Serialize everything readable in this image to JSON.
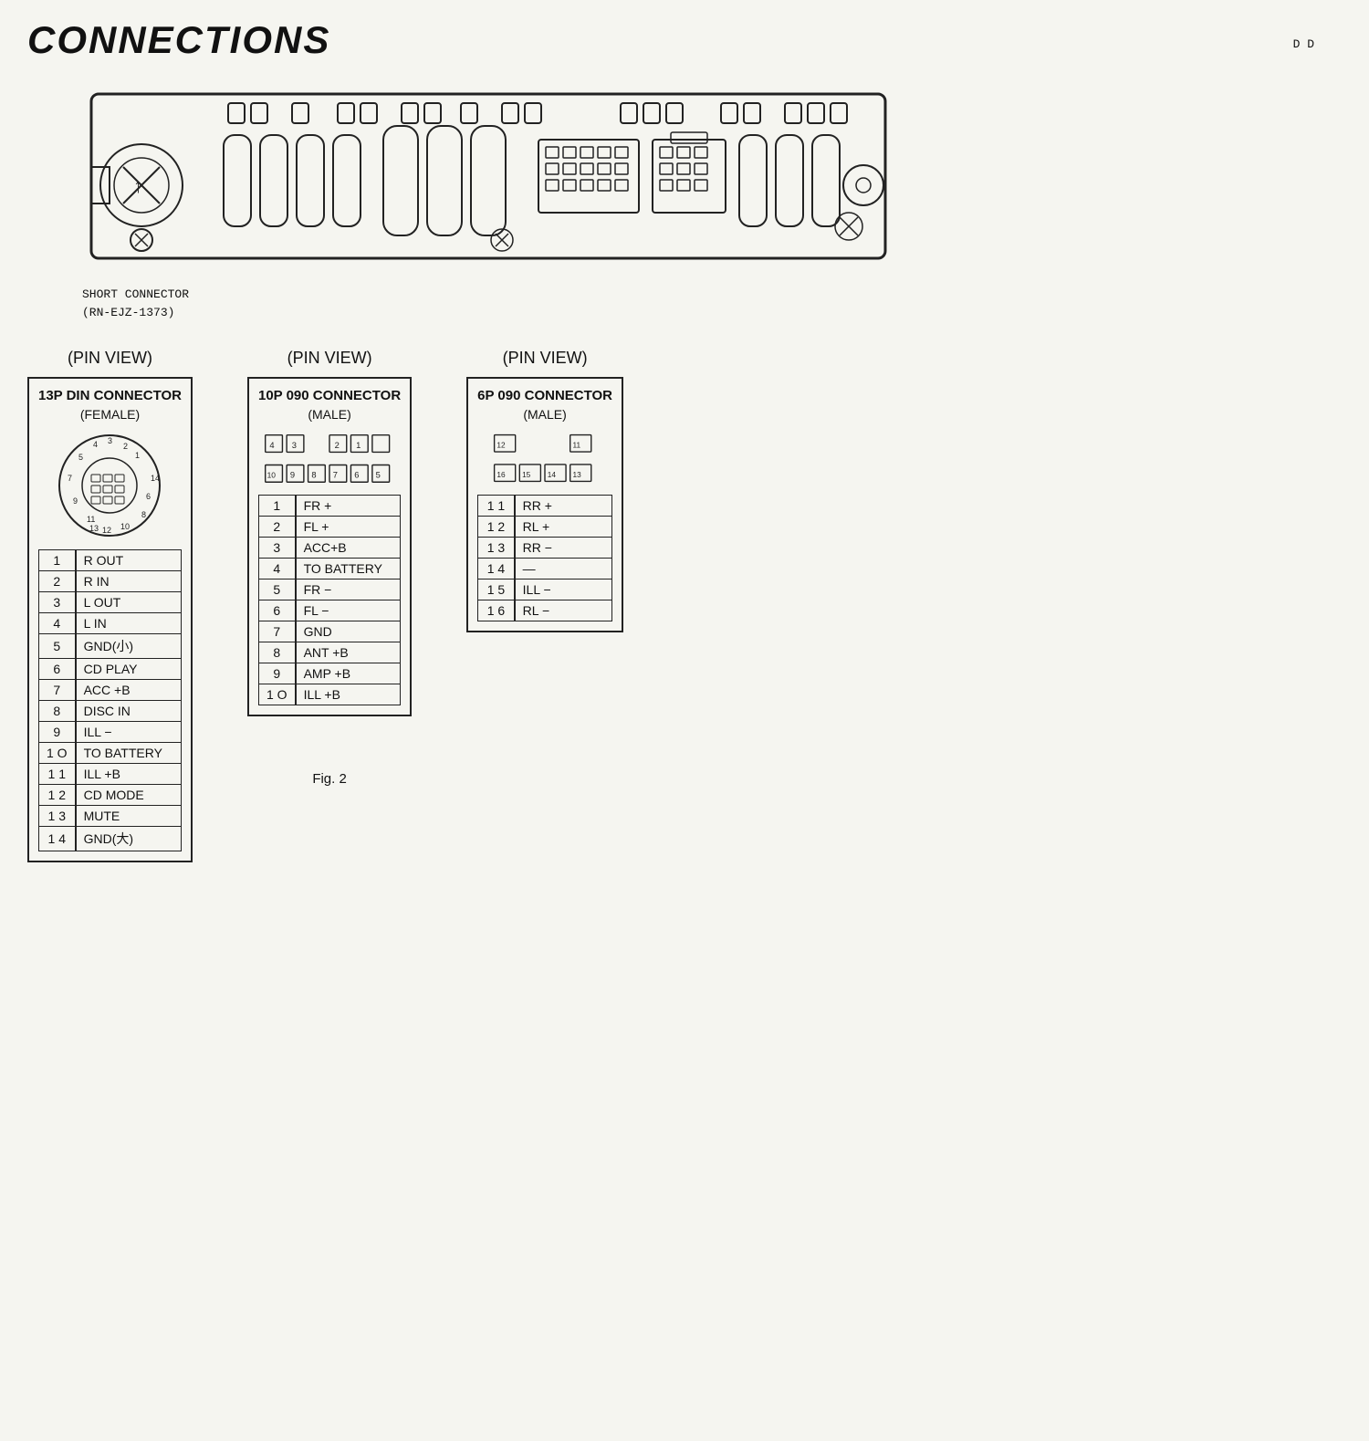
{
  "title": "CONNECTIONS",
  "top_right": "D\nD",
  "short_connector_label": "SHORT CONNECTOR",
  "short_connector_part": "(RN-EJZ-1373)",
  "fig_label": "Fig. 2",
  "connectors": [
    {
      "pin_view_label": "(PIN  VIEW)",
      "title": "13P DIN CONNECTOR",
      "subtitle": "(FEMALE)",
      "type": "circular",
      "pins": [
        {
          "num": "1",
          "label": "R OUT"
        },
        {
          "num": "2",
          "label": "R IN"
        },
        {
          "num": "3",
          "label": "L OUT"
        },
        {
          "num": "4",
          "label": "L IN"
        },
        {
          "num": "5",
          "label": "GND(小)"
        },
        {
          "num": "6",
          "label": "CD PLAY"
        },
        {
          "num": "7",
          "label": "ACC +B"
        },
        {
          "num": "8",
          "label": "DISC IN"
        },
        {
          "num": "9",
          "label": "ILL −"
        },
        {
          "num": "1 O",
          "label": "TO BATTERY"
        },
        {
          "num": "1 1",
          "label": "ILL +B"
        },
        {
          "num": "1 2",
          "label": "CD MODE"
        },
        {
          "num": "1 3",
          "label": "MUTE"
        },
        {
          "num": "1 4",
          "label": "GND(大)"
        }
      ]
    },
    {
      "pin_view_label": "(PIN  VIEW)",
      "title": "10P 090 CONNECTOR",
      "subtitle": "(MALE)",
      "type": "rect10",
      "pins": [
        {
          "num": "1",
          "label": "FR +"
        },
        {
          "num": "2",
          "label": "FL +"
        },
        {
          "num": "3",
          "label": "ACC+B"
        },
        {
          "num": "4",
          "label": "TO BATTERY"
        },
        {
          "num": "5",
          "label": "FR −"
        },
        {
          "num": "6",
          "label": "FL −"
        },
        {
          "num": "7",
          "label": "GND"
        },
        {
          "num": "8",
          "label": "ANT +B"
        },
        {
          "num": "9",
          "label": "AMP +B"
        },
        {
          "num": "1 O",
          "label": "ILL +B"
        }
      ]
    },
    {
      "pin_view_label": "(PIN  VIEW)",
      "title": "6P 090 CONNECTOR",
      "subtitle": "(MALE)",
      "type": "rect6",
      "pins": [
        {
          "num": "1 1",
          "label": "RR +"
        },
        {
          "num": "1 2",
          "label": "RL +"
        },
        {
          "num": "1 3",
          "label": "RR −"
        },
        {
          "num": "1 4",
          "label": "—"
        },
        {
          "num": "1 5",
          "label": "ILL −"
        },
        {
          "num": "1 6",
          "label": "RL −"
        }
      ]
    }
  ]
}
